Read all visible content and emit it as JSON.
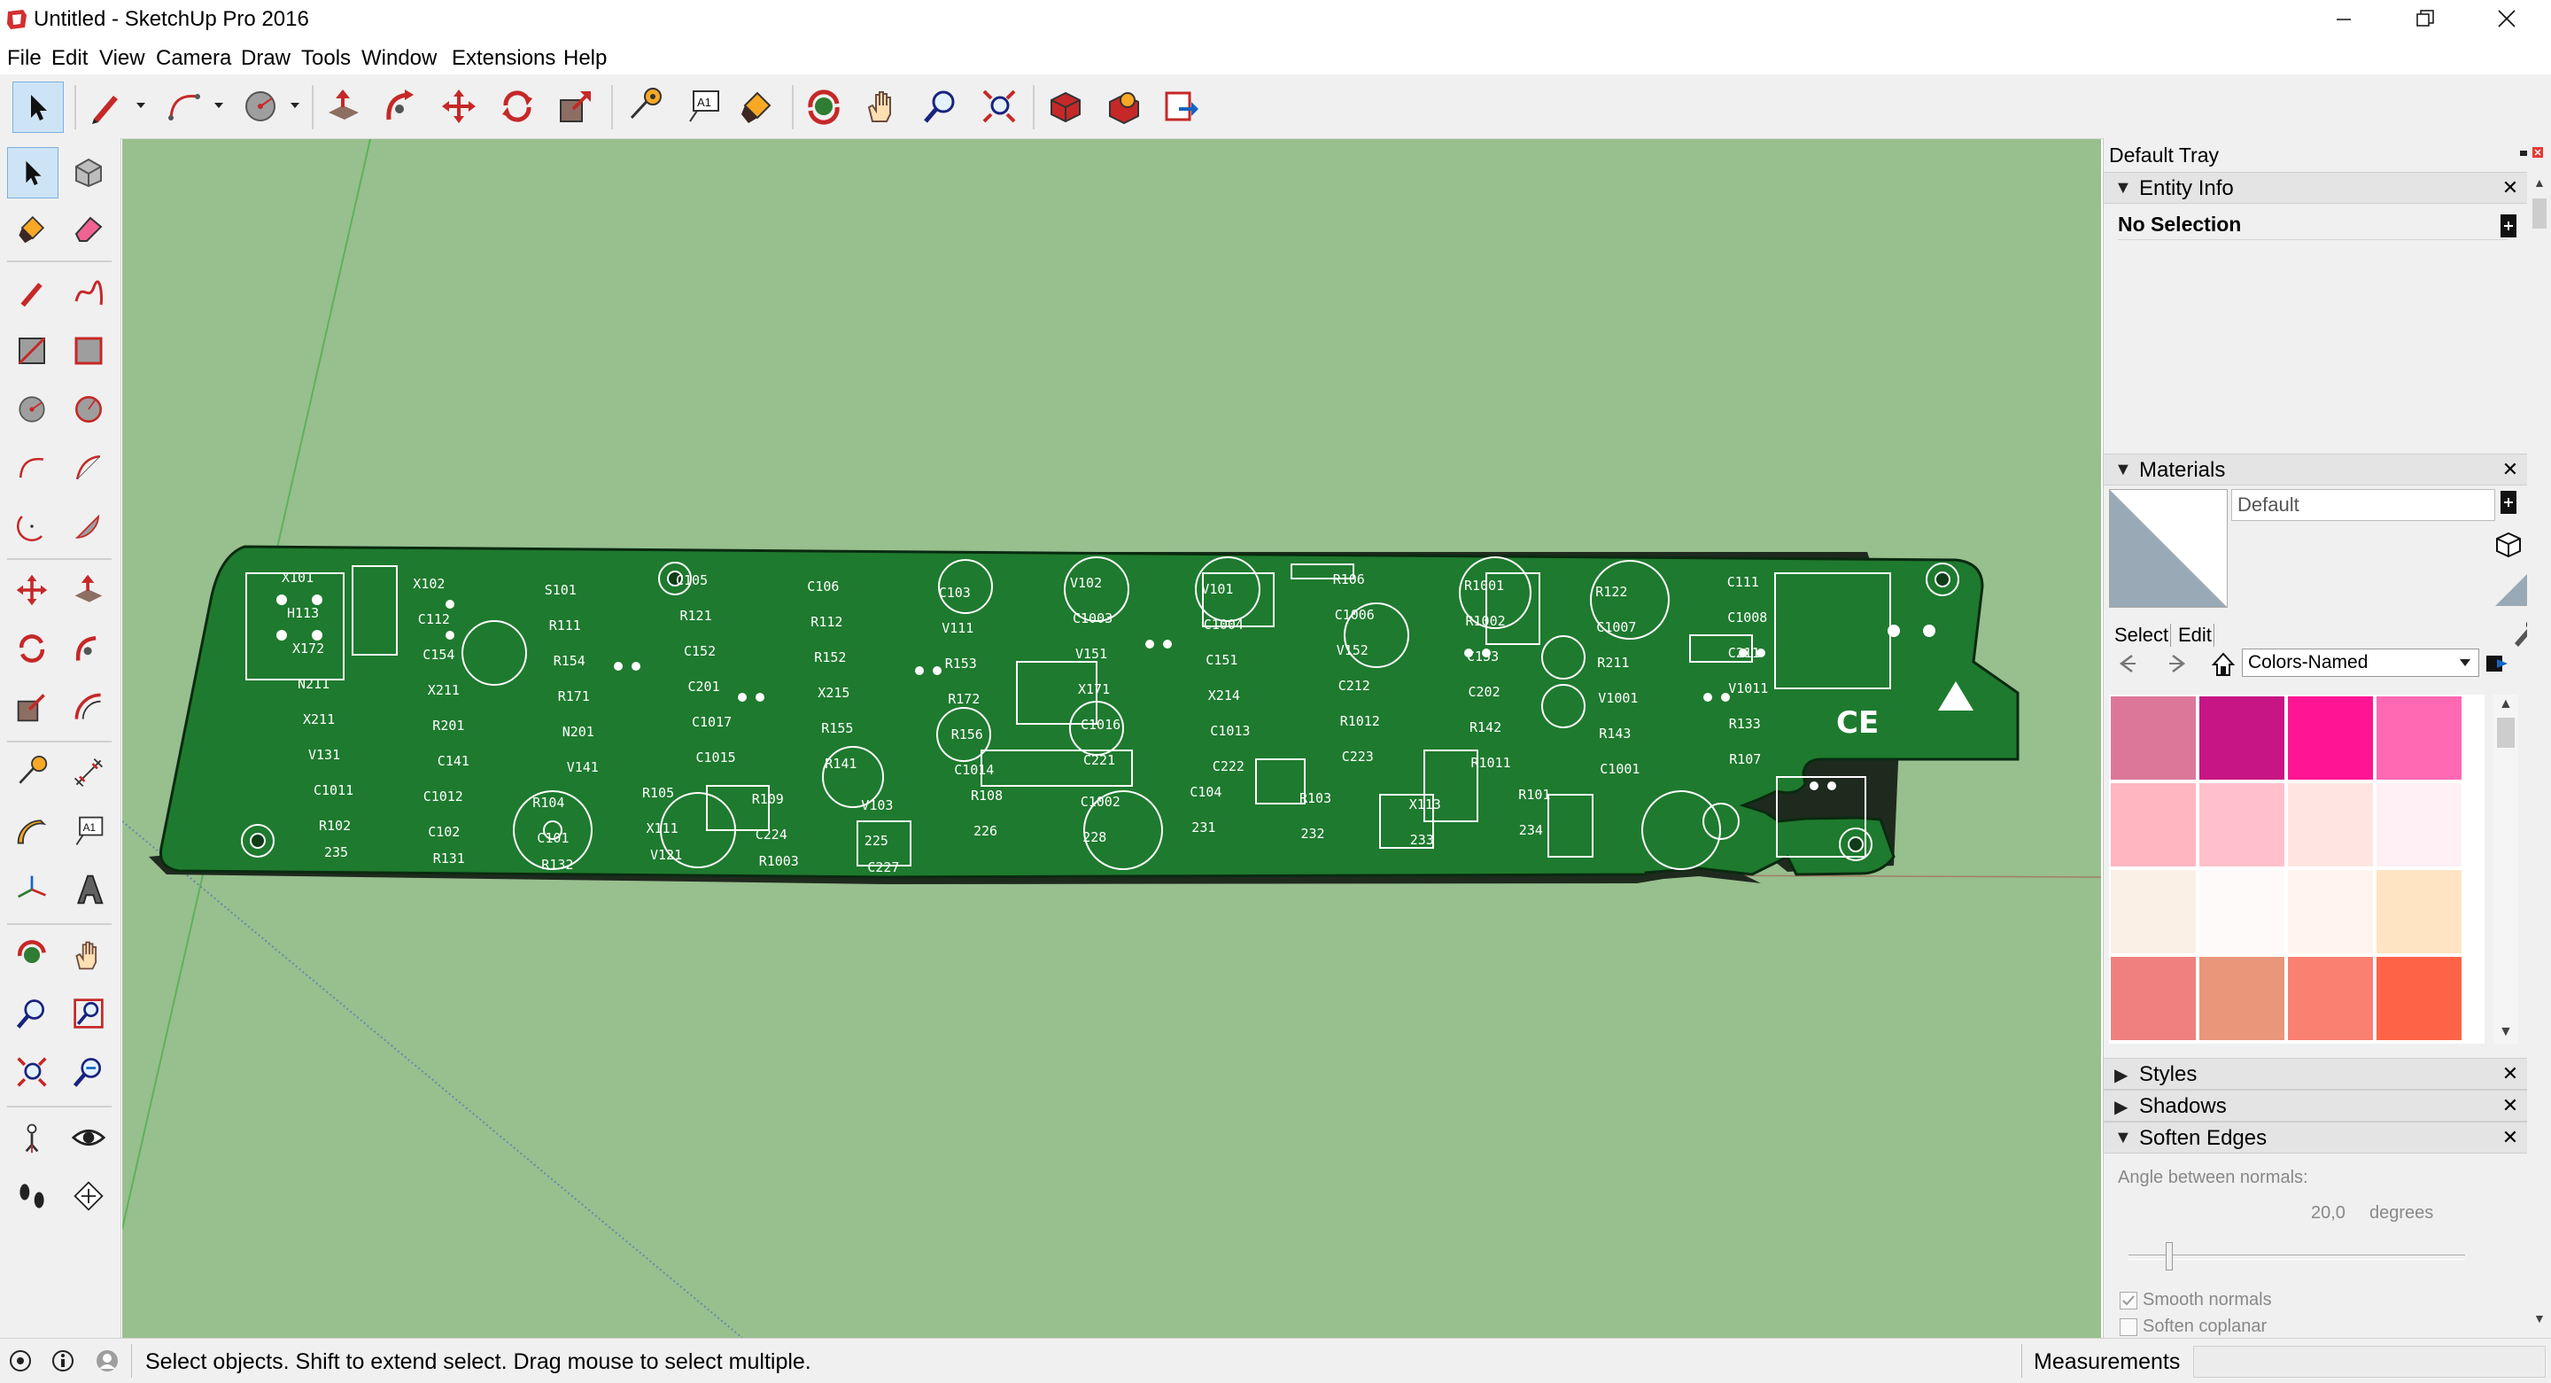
{
  "window": {
    "title": "Untitled - SketchUp Pro 2016",
    "controls": [
      "minimize",
      "restore",
      "close"
    ]
  },
  "menu": [
    "File",
    "Edit",
    "View",
    "Camera",
    "Draw",
    "Tools",
    "Window",
    "Extensions",
    "Help"
  ],
  "toolbar": {
    "buttons": [
      "select-icon",
      "pencil-line-icon",
      "arc-icon",
      "circle-icon",
      "push-pull-icon",
      "follow-me-icon",
      "move-icon",
      "rotate-icon",
      "scale-icon",
      "tape-measure-icon",
      "text-icon",
      "paint-bucket-icon",
      "orbit-icon",
      "pan-icon",
      "zoom-icon",
      "zoom-extents-icon",
      "warehouse-icon",
      "extension-warehouse-icon",
      "send-to-layout-icon"
    ]
  },
  "left_tools": [
    "select",
    "make-component",
    "paint-bucket",
    "eraser",
    "line",
    "freehand",
    "rectangle",
    "rotated-rectangle",
    "circle",
    "polygon",
    "arc",
    "two-point-arc",
    "three-point-arc",
    "pie",
    "move",
    "push-pull",
    "rotate",
    "follow-me",
    "scale",
    "offset",
    "tape-measure",
    "dimension",
    "protractor",
    "text",
    "axes",
    "3d-text",
    "orbit",
    "pan",
    "zoom",
    "zoom-window",
    "zoom-extents",
    "previous",
    "position-camera",
    "look-around",
    "walk",
    "section-plane"
  ],
  "tray": {
    "title": "Default Tray",
    "entity_info": {
      "header": "Entity Info",
      "selection": "No Selection"
    },
    "materials": {
      "header": "Materials",
      "material_name": "Default",
      "tab_select": "Select",
      "tab_edit": "Edit",
      "library": "Colors-Named",
      "swatches": [
        "#dd7799",
        "#c71585",
        "#ff1493",
        "#ff69b4",
        "#ffb6c1",
        "#ffc0cb",
        "#ffe4e1",
        "#fff0f5",
        "#faf0e6",
        "#fffafa",
        "#fff5ee",
        "#ffe4c4",
        "#f08080",
        "#e9967a",
        "#fa8072",
        "#ff6347"
      ]
    },
    "styles": {
      "header": "Styles"
    },
    "shadows": {
      "header": "Shadows"
    },
    "soften_edges": {
      "header": "Soften Edges",
      "angle_label": "Angle between normals:",
      "angle_value": "20,0",
      "angle_unit": "degrees",
      "slider_fraction": 0.11,
      "smooth_normals_label": "Smooth normals",
      "smooth_normals_checked": true,
      "soften_coplanar_label": "Soften coplanar",
      "soften_coplanar_checked": false
    }
  },
  "pcb": {
    "labels": [
      "X101",
      "X102",
      "S101",
      "C105",
      "C106",
      "C103",
      "V102",
      "V101",
      "R106",
      "R1001",
      "R122",
      "C111",
      "H113",
      "C112",
      "R111",
      "R121",
      "R112",
      "V111",
      "C1003",
      "C1004",
      "C1006",
      "R1002",
      "C1007",
      "C1008",
      "X172",
      "C154",
      "R154",
      "C152",
      "R152",
      "R153",
      "V151",
      "C151",
      "V152",
      "C153",
      "R211",
      "C211",
      "N211",
      "X211",
      "R171",
      "C201",
      "X215",
      "R172",
      "X171",
      "X214",
      "C212",
      "C202",
      "V1001",
      "V1011",
      "X211",
      "R201",
      "N201",
      "C1017",
      "R155",
      "R156",
      "C1016",
      "C1013",
      "R1012",
      "R142",
      "R143",
      "R133",
      "V131",
      "C141",
      "V141",
      "C1015",
      "R141",
      "C1014",
      "C221",
      "C222",
      "C223",
      "R1011",
      "C1001",
      "R107",
      "C1011",
      "C1012",
      "R104",
      "R105",
      "R109",
      "V103",
      "R108",
      "C1002",
      "C104",
      "R103",
      "X113",
      "R101",
      "R102",
      "C102",
      "C101",
      "X111",
      "C224",
      "225",
      "226",
      "228",
      "231",
      "232",
      "233",
      "234",
      "235",
      "R131",
      "R132",
      "V121",
      "R1003",
      "C227"
    ],
    "marks": [
      "CE"
    ]
  },
  "status": {
    "message": "Select objects. Shift to extend select. Drag mouse to select multiple.",
    "measurements_label": "Measurements",
    "measurements_value": ""
  }
}
